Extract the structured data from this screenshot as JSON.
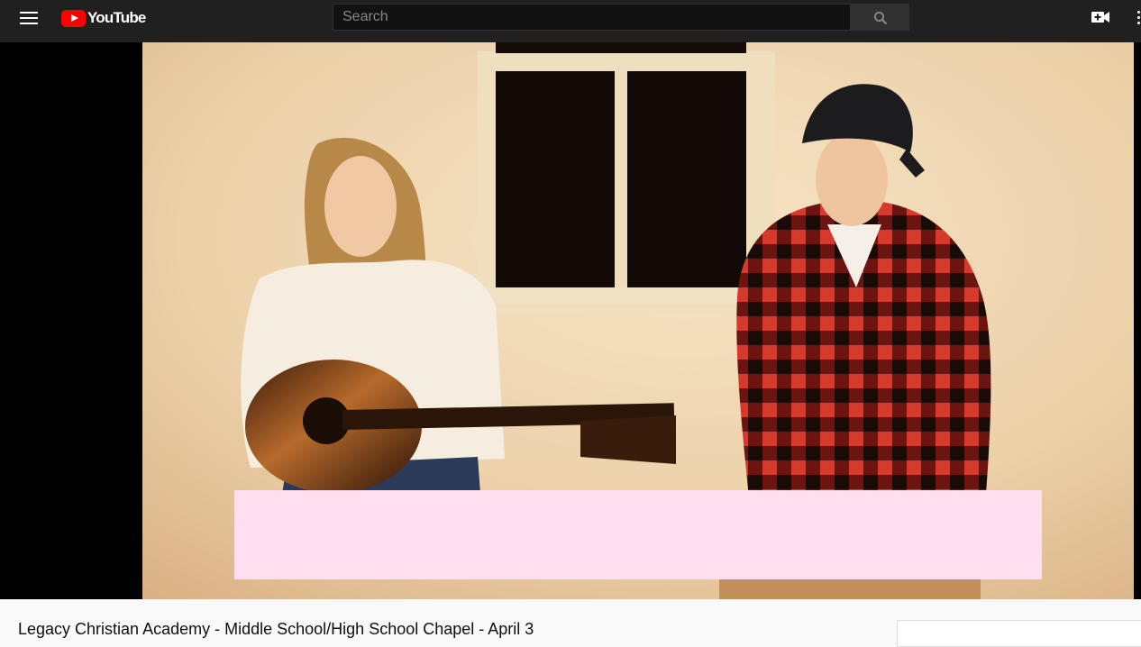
{
  "header": {
    "logo_text": "YouTube",
    "search": {
      "placeholder": "Search",
      "value": ""
    },
    "icons": {
      "menu": "hamburger-menu-icon",
      "search": "search-icon",
      "create": "video-camera-plus-icon",
      "more": "more-vertical-icon"
    }
  },
  "player": {
    "caption_box_color": "#ffdef0"
  },
  "video": {
    "title": "Legacy Christian Academy - Middle School/High School Chapel - April 3"
  },
  "colors": {
    "header_bg": "#202020",
    "brand_red": "#ff0000",
    "page_bg": "#f9f9f9"
  }
}
